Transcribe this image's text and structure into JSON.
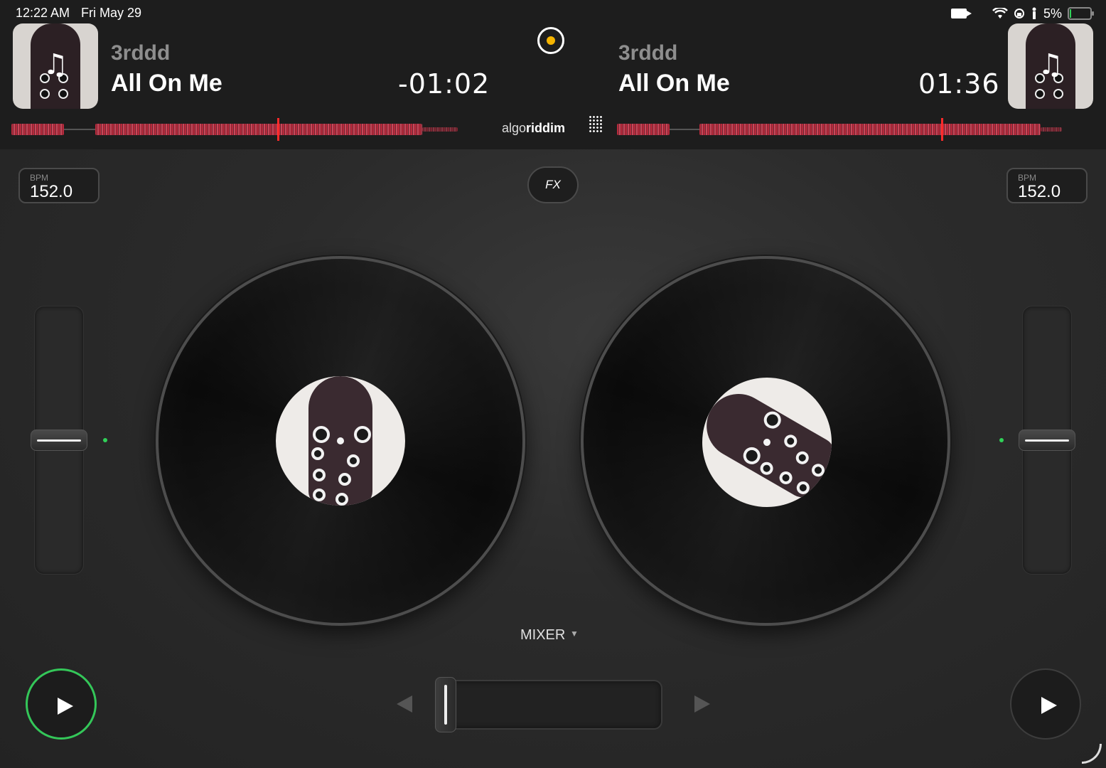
{
  "status_bar": {
    "time": "12:22 AM",
    "date": "Fri May 29",
    "battery": "5%"
  },
  "deck_a": {
    "artist": "3rddd",
    "title": "All On Me",
    "time": "-01:02",
    "bpm_label": "BPM",
    "bpm": "152.0"
  },
  "deck_b": {
    "artist": "3rddd",
    "title": "All On Me",
    "time": "01:36",
    "bpm_label": "BPM",
    "bpm": "152.0"
  },
  "header": {
    "logo_prefix": "algo",
    "logo_suffix": "riddim"
  },
  "controls": {
    "fx_label": "FX",
    "mixer_label": "MIXER"
  },
  "colors": {
    "accent_green": "#34c759",
    "record_dot": "#f5b400",
    "waveform": "#b72a3c",
    "playhead": "#ff2a2a"
  }
}
